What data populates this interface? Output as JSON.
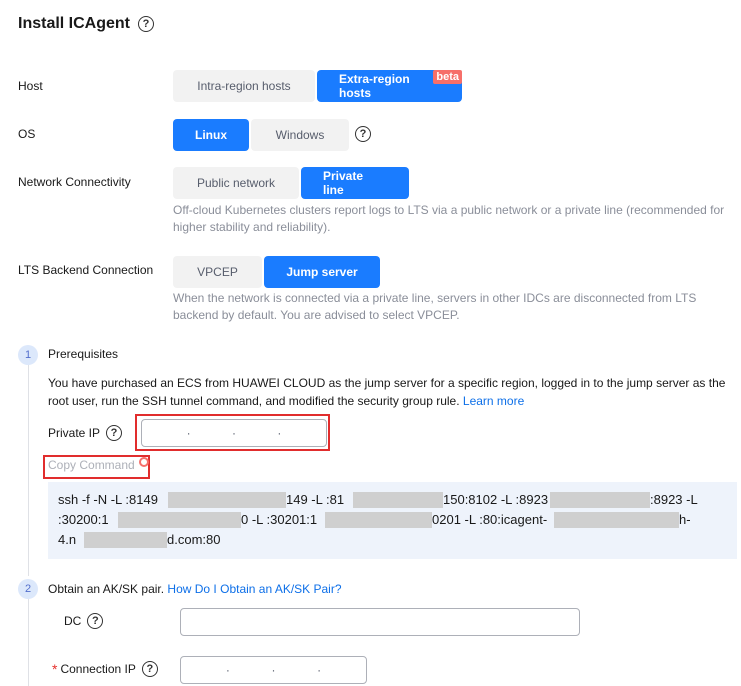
{
  "page": {
    "title": "Install ICAgent"
  },
  "host": {
    "label": "Host",
    "options": [
      "Intra-region hosts",
      "Extra-region hosts"
    ],
    "selected": "Extra-region hosts",
    "badge": "beta"
  },
  "os": {
    "label": "OS",
    "options": [
      "Linux",
      "Windows"
    ],
    "selected": "Linux"
  },
  "network": {
    "label": "Network Connectivity",
    "options": [
      "Public network",
      "Private line"
    ],
    "selected": "Private line",
    "hint": "Off-cloud Kubernetes clusters report logs to LTS via a public network or a private line (recommended for higher stability and reliability)."
  },
  "backend": {
    "label": "LTS Backend Connection",
    "options": [
      "VPCEP",
      "Jump server"
    ],
    "selected": "Jump server",
    "hint": "When the network is connected via a private line, servers in other IDCs are disconnected from LTS backend by default. You are advised to select VPCEP."
  },
  "step1": {
    "number": "1",
    "title": "Prerequisites",
    "description": "You have purchased an ECS from HUAWEI CLOUD as the jump server for a specific region, logged in to the jump server as the root user, run the SSH tunnel command, and modified the security group rule.",
    "learn_more": "Learn more",
    "private_ip_label": "Private IP",
    "private_ip_value": "",
    "copy_command": "Copy Command",
    "command": {
      "line1": [
        "ssh -f -N -L :8149",
        "149 -L :81",
        "150:8102 -L :8923",
        ":8923 -L"
      ],
      "line2": [
        ":30200:1",
        "0 -L :30201:1",
        "0201 -L :80:icagent-",
        "h-"
      ],
      "line3": [
        "4.n",
        "d.com:80"
      ]
    }
  },
  "step2": {
    "number": "2",
    "title": "Obtain an AK/SK pair.",
    "link": "How Do I Obtain an AK/SK Pair?",
    "dc_label": "DC",
    "dc_value": "",
    "connection_ip_label": "Connection IP",
    "connection_ip_required": "*",
    "connection_ip_value": ""
  },
  "colors": {
    "primary": "#1a7cff",
    "highlight_border": "#e12d2d",
    "beta_badge": "#f66f6a",
    "link": "#0d6fe8"
  }
}
